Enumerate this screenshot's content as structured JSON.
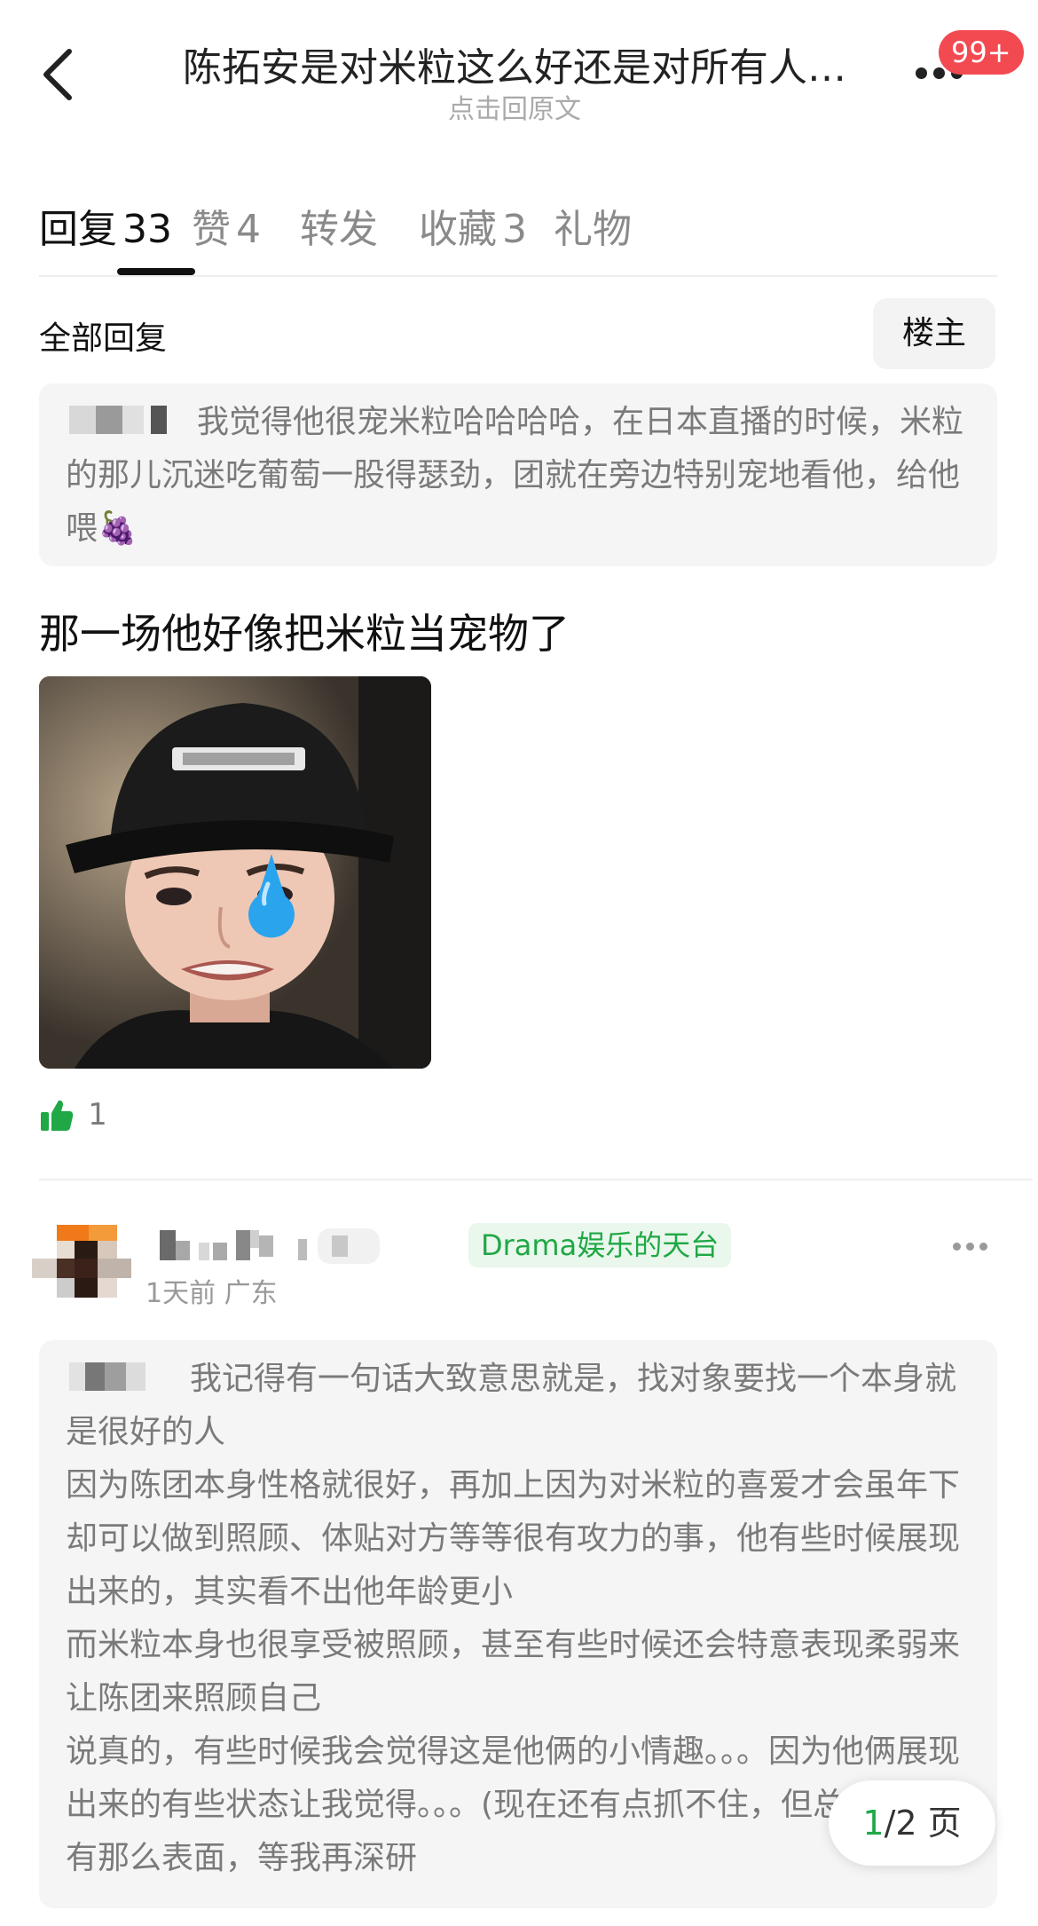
{
  "header": {
    "title": "陈拓安是对米粒这么好还是对所有人…",
    "subtitle": "点击回原文",
    "badge": "99+"
  },
  "tabs": [
    {
      "label": "回复",
      "count": "33"
    },
    {
      "label": "赞",
      "count": "4"
    },
    {
      "label": "转发",
      "count": ""
    },
    {
      "label": "收藏",
      "count": "3"
    },
    {
      "label": "礼物",
      "count": ""
    }
  ],
  "replies_bar": {
    "title": "全部回复",
    "op_label": "楼主"
  },
  "reply1": {
    "quote": "我觉得他很宠米粒哈哈哈哈，在日本直播的时候，米粒的那儿沉迷吃葡萄一股得瑟劲，团就在旁边特别宠地看他，给他喂🍇",
    "text": "那一场他好像把米粒当宠物了",
    "likes": "1"
  },
  "post2": {
    "tag": "Drama娱乐的天台",
    "meta": "1天前  广东",
    "quote_lines": [
      "我记得有一句话大致意思就是，找对象要找一个本身就是很好的人",
      "因为陈团本身性格就很好，再加上因为对米粒的喜爱才会虽年下却可以做到照顾、体贴对方等等很有攻力的事，他有些时候展现出来的，其实看不出他年龄更小",
      "而米粒本身也很享受被照顾，甚至有些时候还会特意表现柔弱来让陈团来照顾自己",
      "说真的，有些时候我会觉得这是他俩的小情趣。。。因为他俩展现出来的有些状态让我觉得。。。(现在还有点抓不住，但总觉得没有那么表面，等我再深研"
    ]
  },
  "pager": {
    "current": "1",
    "total": "/2 页"
  },
  "colors": {
    "accent_green": "#1fa845",
    "badge_red": "#f24a50",
    "quote_bg": "#f5f5f5"
  }
}
